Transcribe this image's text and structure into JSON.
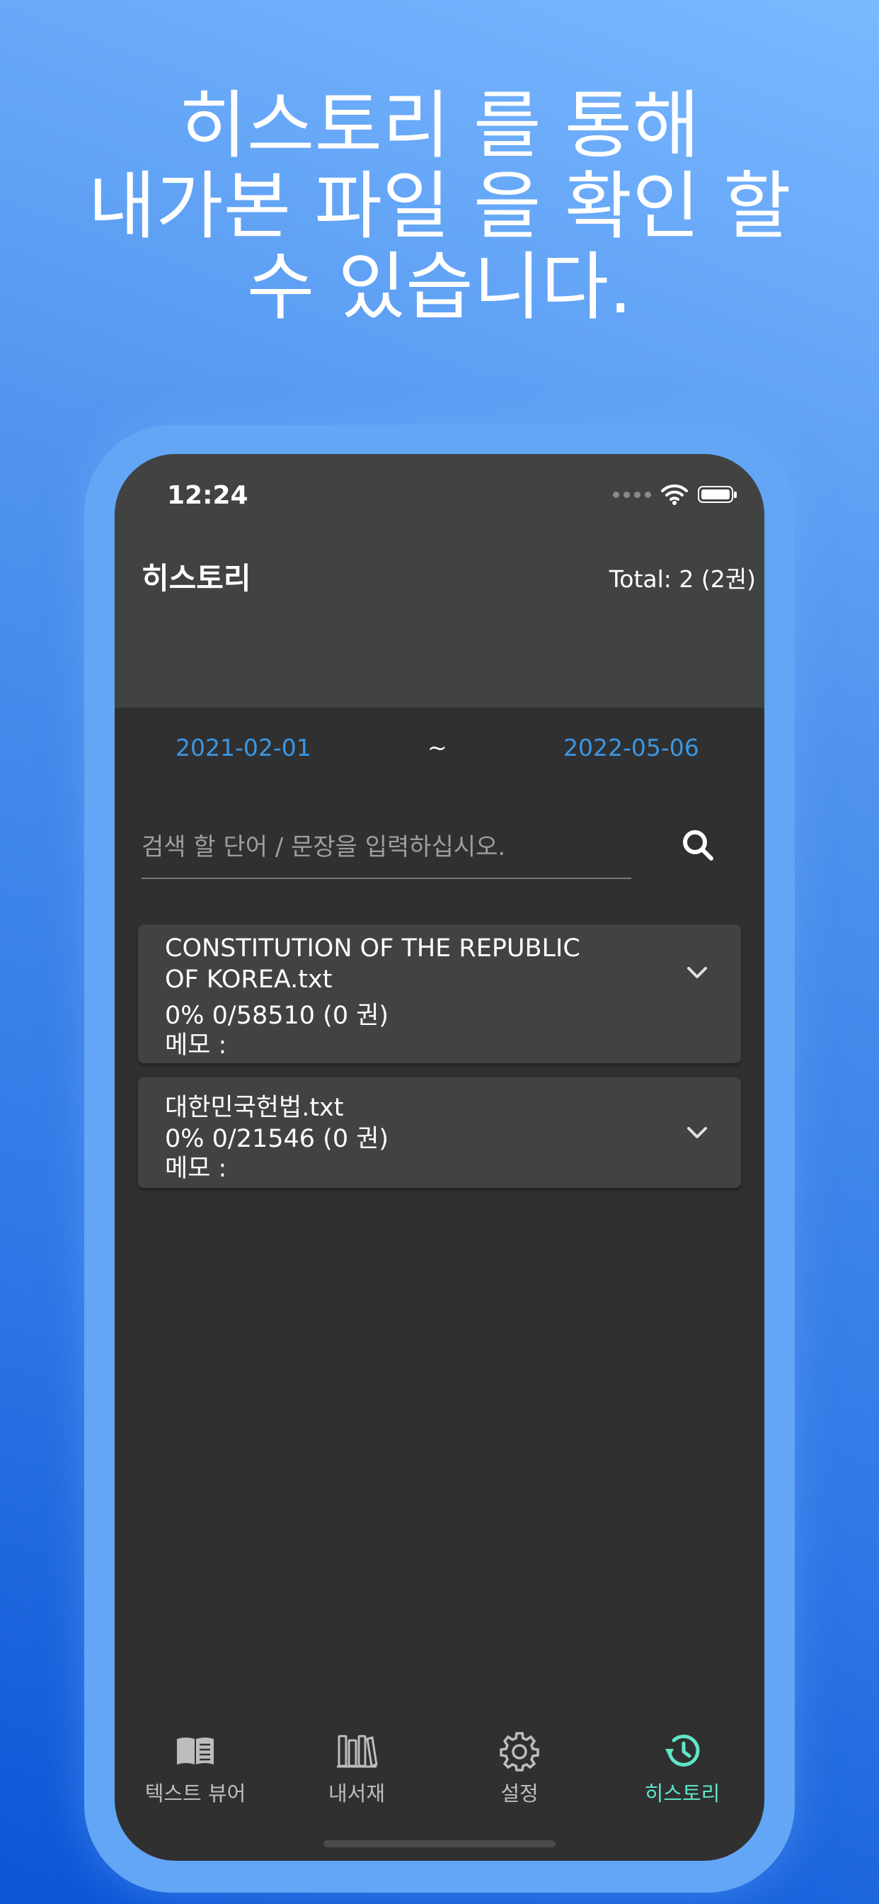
{
  "promo": {
    "lines": [
      "히스토리 를 통해",
      "내가본 파일 을 확인 할",
      "수 있습니다."
    ]
  },
  "status_bar": {
    "time": "12:24"
  },
  "header": {
    "title": "히스토리",
    "total": "Total: 2  (2권)"
  },
  "date_range": {
    "start": "2021-02-01",
    "separator": "~",
    "end": "2022-05-06"
  },
  "search": {
    "placeholder": "검색 할 단어 / 문장을 입력하십시오.",
    "value": ""
  },
  "history_items": [
    {
      "title_lines": [
        "CONSTITUTION OF THE REPUBLIC",
        "OF KOREA.txt"
      ],
      "progress": "0% 0/58510 (0 권)",
      "memo": "메모 :"
    },
    {
      "title_lines": [
        "대한민국헌법.txt"
      ],
      "progress": "0% 0/21546 (0 권)",
      "memo": "메모 :"
    }
  ],
  "tabs": [
    {
      "label": "텍스트 뷰어",
      "icon": "book-open-icon",
      "active": false
    },
    {
      "label": "내서재",
      "icon": "library-icon",
      "active": false
    },
    {
      "label": "설정",
      "icon": "gear-icon",
      "active": false
    },
    {
      "label": "히스토리",
      "icon": "history-icon",
      "active": true
    }
  ],
  "colors": {
    "accent_date": "#3a97e4",
    "active_tab": "#5fe6c8",
    "header_bg": "#424242",
    "screen_bg": "#303030",
    "card_bg": "#424242"
  }
}
